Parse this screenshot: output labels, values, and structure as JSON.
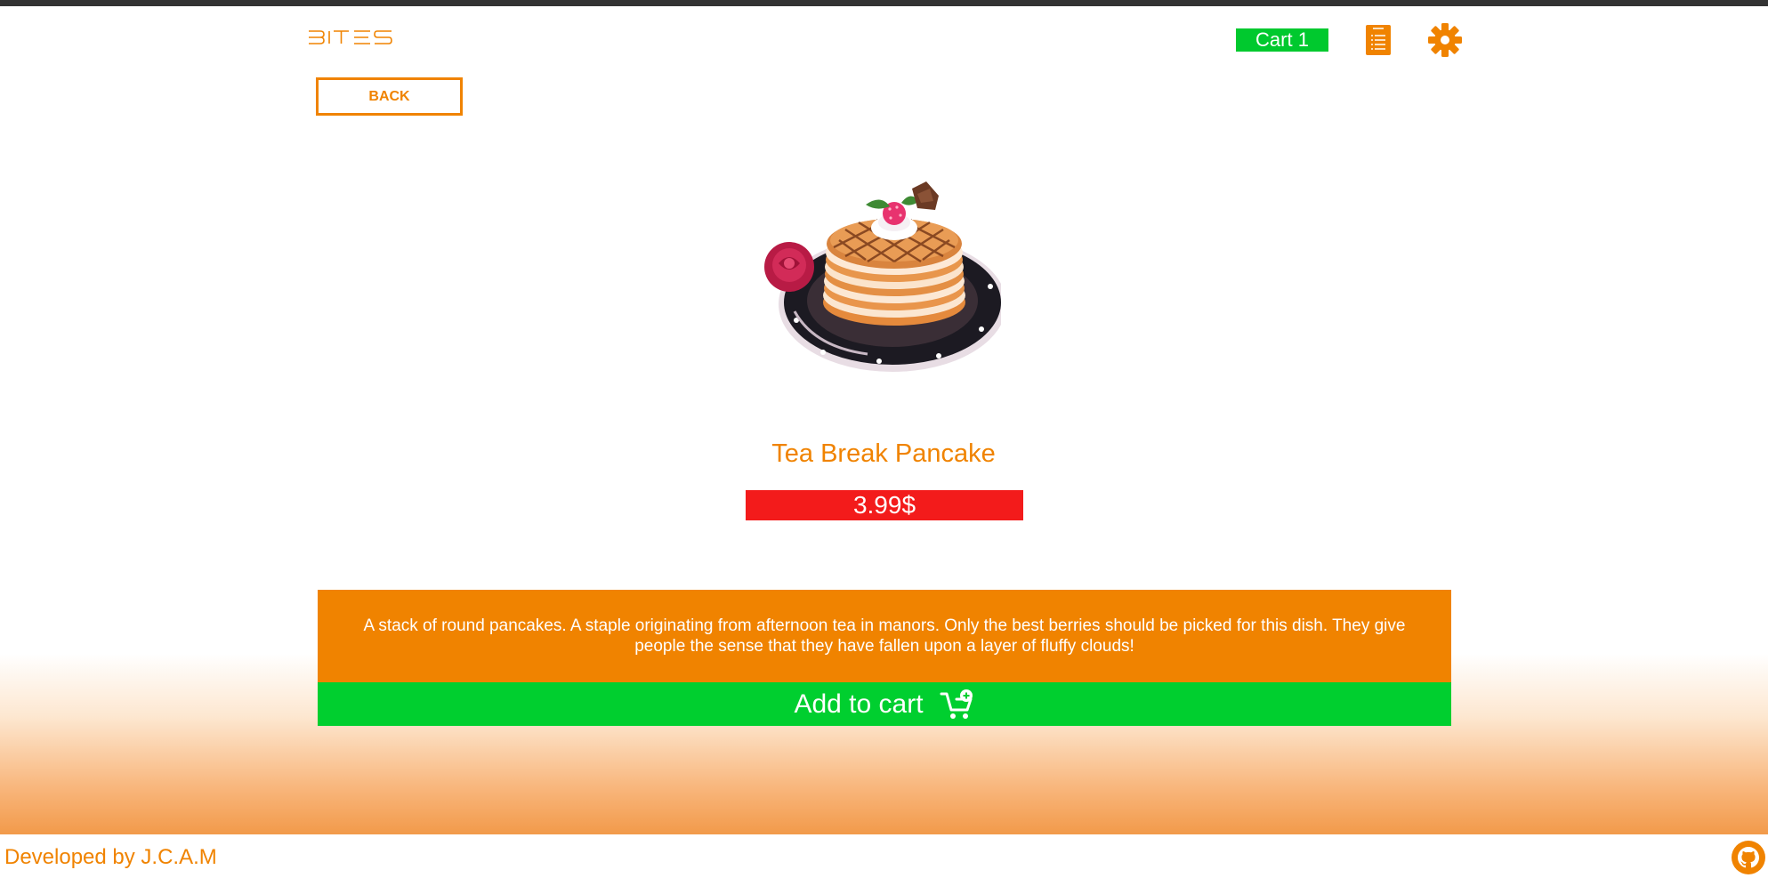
{
  "header": {
    "logo_text": "BITES",
    "cart_label": "Cart 1",
    "orders_icon": "list-document-icon",
    "settings_icon": "gear-icon"
  },
  "navigation": {
    "back_label": "BACK"
  },
  "product": {
    "image_icon": "pancake-stack-image",
    "name": "Tea Break Pancake",
    "price": "3.99$",
    "description": "A stack of round pancakes. A staple originating from afternoon tea in manors. Only the best berries should be picked for this dish. They give people the sense that they have fallen upon a layer of fluffy clouds!",
    "add_to_cart_label": "Add to cart",
    "add_to_cart_icon": "cart-plus-icon"
  },
  "footer": {
    "credit": "Developed by J.C.A.M",
    "github_icon": "github-icon"
  },
  "colors": {
    "accent_orange": "#f08300",
    "cart_green": "#00c92e",
    "price_red": "#f31b1b",
    "topbar_dark": "#333333"
  }
}
